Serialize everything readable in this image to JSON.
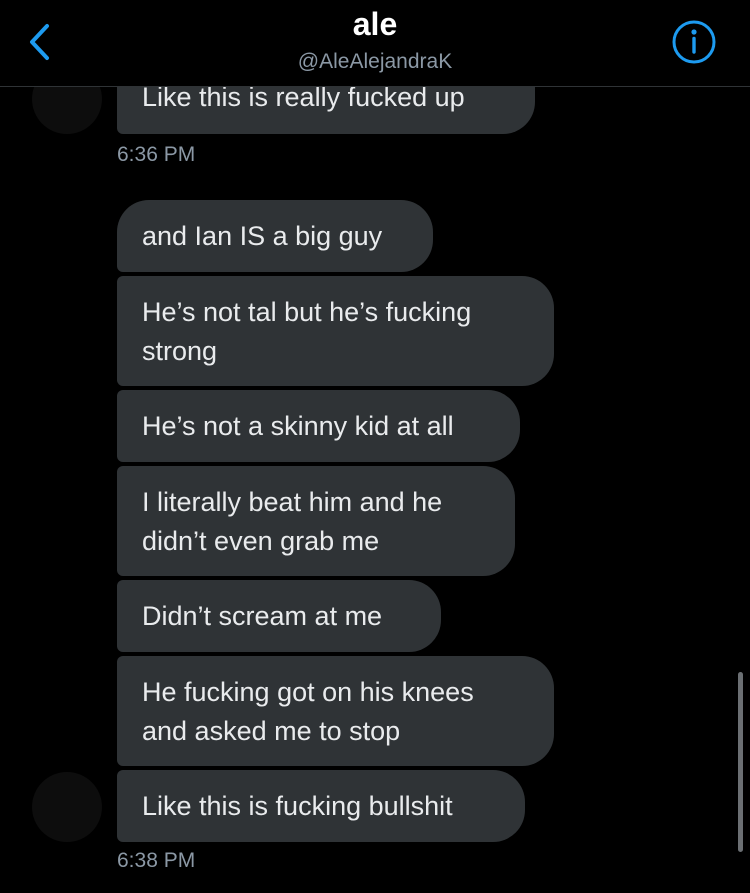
{
  "header": {
    "title": "ale",
    "handle": "@AleAlejandraK"
  },
  "colors": {
    "accent": "#1d9bf0",
    "bubble": "#2f3336",
    "background": "#000000",
    "muted": "#8b98a5"
  },
  "icons": {
    "back": "chevron-left-icon",
    "info": "info-icon"
  },
  "messages": [
    {
      "text": "Like this is really fucked up"
    },
    {
      "text": "and Ian IS a big guy"
    },
    {
      "text_line1": "He’s not tal but he’s fucking",
      "text_line2": "strong"
    },
    {
      "text": "He’s not a skinny kid at all"
    },
    {
      "text_line1": "I literally beat him and he",
      "text_line2": "didn’t even grab me"
    },
    {
      "text": "Didn’t scream at me"
    },
    {
      "text_line1": "He fucking got on his knees",
      "text_line2": "and asked me to stop"
    },
    {
      "text": "Like this is fucking bullshit"
    }
  ],
  "timestamps": [
    "6:36 PM",
    "6:38 PM"
  ]
}
